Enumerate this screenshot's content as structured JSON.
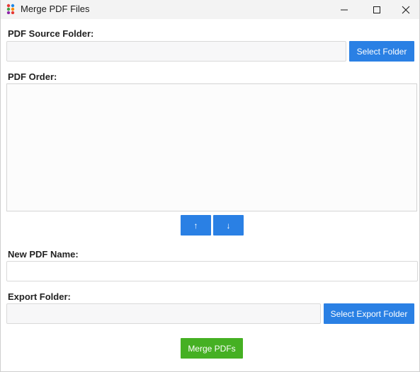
{
  "window": {
    "title": "Merge PDF Files",
    "controls": {
      "minimize": "minimize-icon",
      "maximize": "maximize-icon",
      "close": "close-icon"
    }
  },
  "source": {
    "label": "PDF Source Folder:",
    "value": "",
    "button_label": "Select Folder"
  },
  "order": {
    "label": "PDF Order:",
    "items": [],
    "up_label": "↑",
    "down_label": "↓"
  },
  "name": {
    "label": "New PDF Name:",
    "value": ""
  },
  "export": {
    "label": "Export Folder:",
    "value": "",
    "button_label": "Select Export Folder"
  },
  "merge": {
    "button_label": "Merge PDFs"
  },
  "colors": {
    "accent_blue": "#2a80e4",
    "merge_green": "#45b023",
    "titlebar_bg": "#f3f3f3"
  }
}
